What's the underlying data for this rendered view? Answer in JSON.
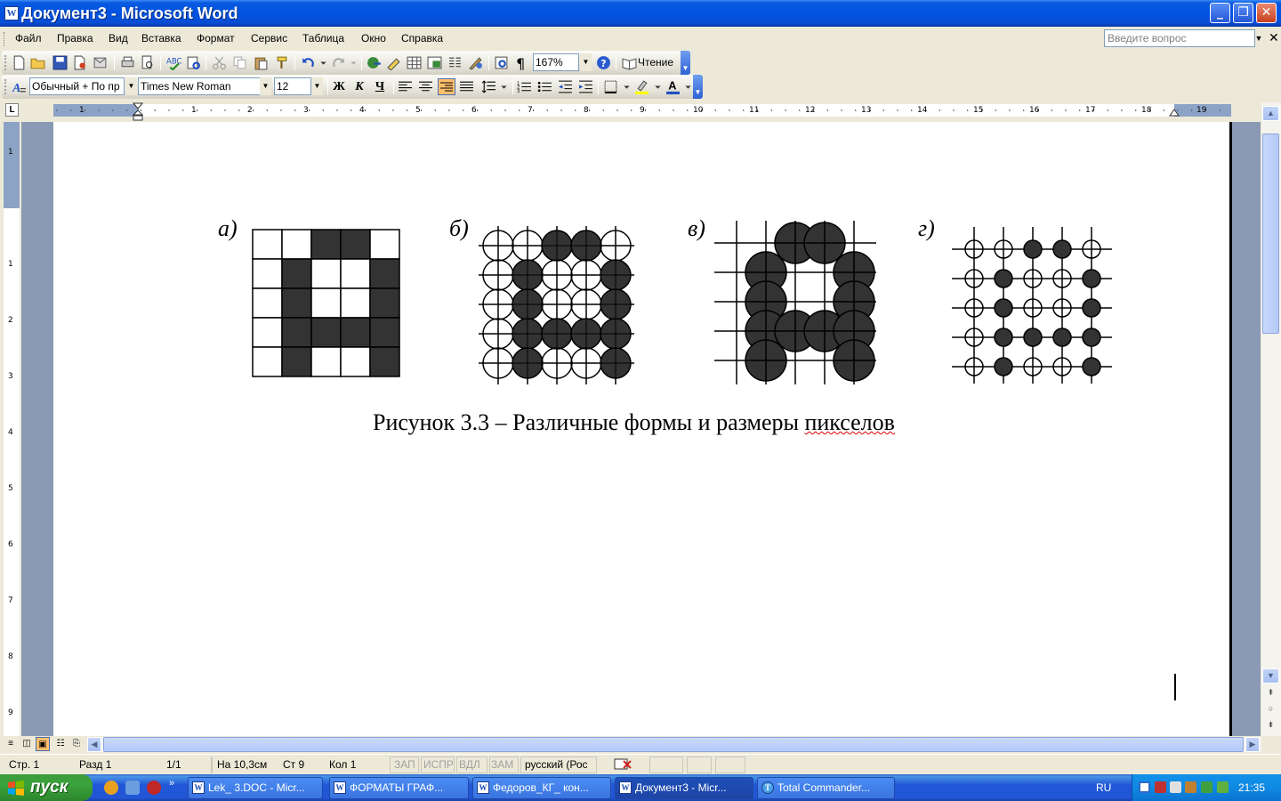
{
  "window": {
    "title": "Документ3 - Microsoft Word",
    "icon_letter": "W"
  },
  "menu": {
    "items": [
      "Файл",
      "Правка",
      "Вид",
      "Вставка",
      "Формат",
      "Сервис",
      "Таблица",
      "Окно",
      "Справка"
    ],
    "ask_placeholder": "Введите вопрос"
  },
  "toolbar_standard": {
    "zoom": "167%",
    "reading_label": "Чтение"
  },
  "toolbar_formatting": {
    "style": "Обычный + По пр",
    "font": "Times New Roman",
    "size": "12",
    "bold": "Ж",
    "italic": "К",
    "underline": "Ч",
    "active_alignment": "align-right"
  },
  "ruler": {
    "h_numbers": [
      "1",
      "1",
      "2",
      "3",
      "4",
      "5",
      "6",
      "7",
      "8",
      "9",
      "10",
      "11",
      "12",
      "13",
      "14",
      "15",
      "16",
      "17",
      "18",
      "19"
    ],
    "v_numbers": [
      "1",
      "1",
      "2",
      "3",
      "4",
      "5",
      "6",
      "7",
      "8",
      "9"
    ]
  },
  "document": {
    "labels": [
      "а)",
      "б)",
      "в)",
      "г)"
    ],
    "figure_a": {
      "grid": [
        [
          0,
          0,
          1,
          1,
          0
        ],
        [
          0,
          1,
          0,
          0,
          1
        ],
        [
          0,
          1,
          0,
          0,
          1
        ],
        [
          0,
          1,
          1,
          1,
          1
        ],
        [
          0,
          1,
          0,
          0,
          1
        ]
      ]
    },
    "figure_b": {
      "grid": [
        [
          0,
          0,
          1,
          1,
          0
        ],
        [
          0,
          1,
          0,
          0,
          1
        ],
        [
          0,
          1,
          0,
          0,
          1
        ],
        [
          0,
          1,
          1,
          1,
          1
        ],
        [
          0,
          1,
          0,
          0,
          1
        ]
      ]
    },
    "figure_c": {
      "grid": [
        [
          0,
          0,
          1,
          1,
          0
        ],
        [
          0,
          1,
          0,
          0,
          1
        ],
        [
          0,
          1,
          0,
          0,
          1
        ],
        [
          0,
          1,
          1,
          1,
          1
        ],
        [
          0,
          1,
          0,
          0,
          1
        ]
      ]
    },
    "figure_d": {
      "grid": [
        [
          0,
          0,
          1,
          1,
          0
        ],
        [
          0,
          1,
          0,
          0,
          1
        ],
        [
          0,
          1,
          0,
          0,
          1
        ],
        [
          0,
          1,
          1,
          1,
          1
        ],
        [
          0,
          1,
          0,
          0,
          1
        ]
      ]
    },
    "caption_main": "Рисунок 3.3 – Различные формы и размеры ",
    "caption_misspelled": "пикселов"
  },
  "statusbar": {
    "page": "Стр. 1",
    "section": "Разд 1",
    "pages": "1/1",
    "at": "На 10,3см",
    "line": "Ст 9",
    "col": "Кол 1",
    "rec": "ЗАП",
    "trk": "ИСПР",
    "ext": "ВДЛ",
    "ovr": "ЗАМ",
    "language": "русский (Рос"
  },
  "taskbar": {
    "start_label": "пуск",
    "tasks": [
      {
        "label": "Lek_ 3.DOC - Micr...",
        "icon": "word-icon",
        "active": false
      },
      {
        "label": "ФОРМАТЫ ГРАФ...",
        "icon": "word-icon",
        "active": false
      },
      {
        "label": "Федоров_КГ_ кон...",
        "icon": "word-icon",
        "active": false
      },
      {
        "label": "Документ3 - Micr...",
        "icon": "word-icon",
        "active": true
      },
      {
        "label": "Total Commander...",
        "icon": "total-commander-icon",
        "active": false
      }
    ],
    "language": "RU",
    "clock": "21:35"
  },
  "colors": {
    "xp_blue": "#0053e1",
    "page_bg": "#ffffff",
    "doc_bg": "#8a9ab5",
    "fill_dark": "#333333",
    "start_green": "#3aa33a"
  }
}
